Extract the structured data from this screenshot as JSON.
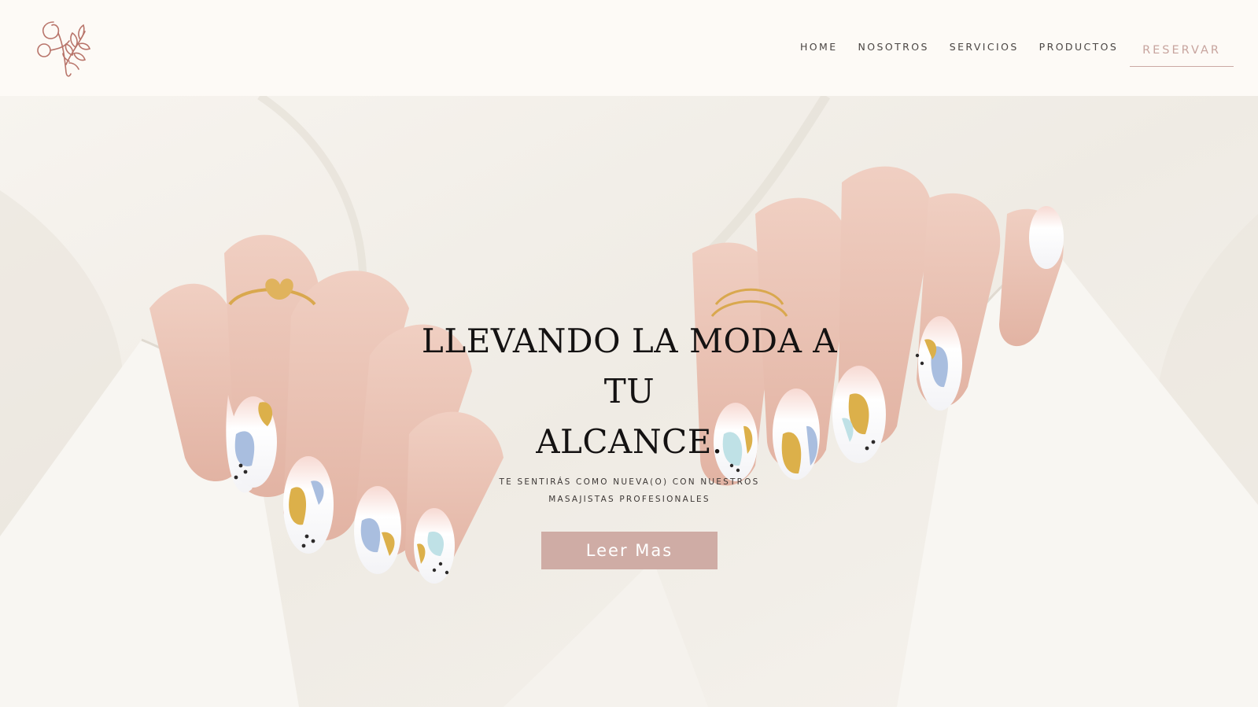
{
  "brand": {
    "logo_icon": "botanical-monogram-logo",
    "accent_color": "#b8746a"
  },
  "nav": {
    "items": [
      {
        "label": "HOME"
      },
      {
        "label": "NOSOTROS"
      },
      {
        "label": "SERVICIOS"
      },
      {
        "label": "PRODUCTOS"
      }
    ],
    "reserve_label": "RESERVAR"
  },
  "hero": {
    "title_line1": "LLEVANDO LA MODA A TU",
    "title_line2": "ALCANCE.",
    "subtitle": "TE SENTIRÁS COMO NUEVA(O) CON NUESTROS MASAJISTAS PROFESIONALES",
    "cta_label": "Leer Mas",
    "cta_color": "#cfaca5",
    "background_image": "hands-with-pastel-nail-art-on-white-fabric"
  }
}
